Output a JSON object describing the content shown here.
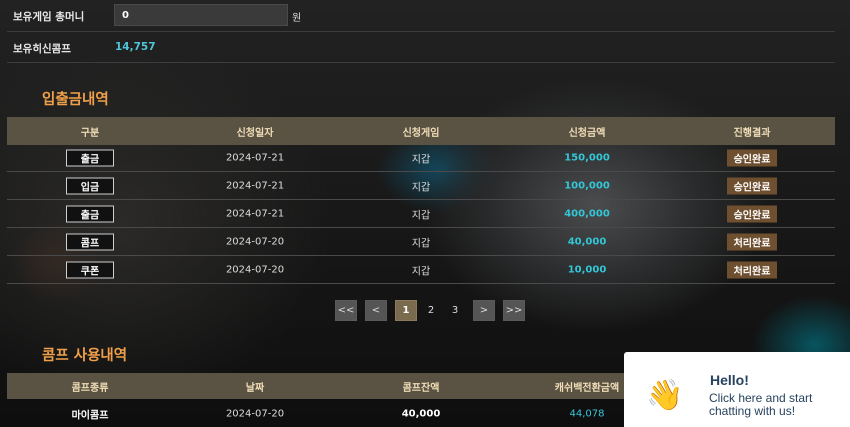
{
  "account": {
    "game_money_label": "보유게임 총머니",
    "game_money_value": "0",
    "currency_unit": "원",
    "comp_label": "보유히신콤프",
    "comp_value": "14,757"
  },
  "transactions": {
    "title": "입출금내역",
    "headers": [
      "구분",
      "신청일자",
      "신청게임",
      "신청금액",
      "진행결과"
    ],
    "rows": [
      {
        "type": "출금",
        "date": "2024-07-21",
        "game": "지갑",
        "amount": "150,000",
        "status": "승인완료"
      },
      {
        "type": "입금",
        "date": "2024-07-21",
        "game": "지갑",
        "amount": "100,000",
        "status": "승인완료"
      },
      {
        "type": "출금",
        "date": "2024-07-21",
        "game": "지갑",
        "amount": "400,000",
        "status": "승인완료"
      },
      {
        "type": "콤프",
        "date": "2024-07-20",
        "game": "지갑",
        "amount": "40,000",
        "status": "처리완료"
      },
      {
        "type": "쿠폰",
        "date": "2024-07-20",
        "game": "지갑",
        "amount": "10,000",
        "status": "처리완료"
      }
    ]
  },
  "pagination": {
    "first": "<<",
    "prev": "<",
    "pages": [
      "1",
      "2",
      "3"
    ],
    "active_page": "1",
    "next": ">",
    "last": ">>"
  },
  "comp_usage": {
    "title": "콤프 사용내역",
    "headers": [
      "콤프종류",
      "날짜",
      "콤프잔액",
      "캐쉬백전환금액"
    ],
    "rows": [
      {
        "kind": "마이콤프",
        "date": "2024-07-20",
        "balance": "40,000",
        "cashback": "44,078"
      }
    ]
  },
  "chat_widget": {
    "title": "Hello!",
    "subtitle": "Click here and start chatting with us!",
    "icon": "waving-hand-icon"
  }
}
